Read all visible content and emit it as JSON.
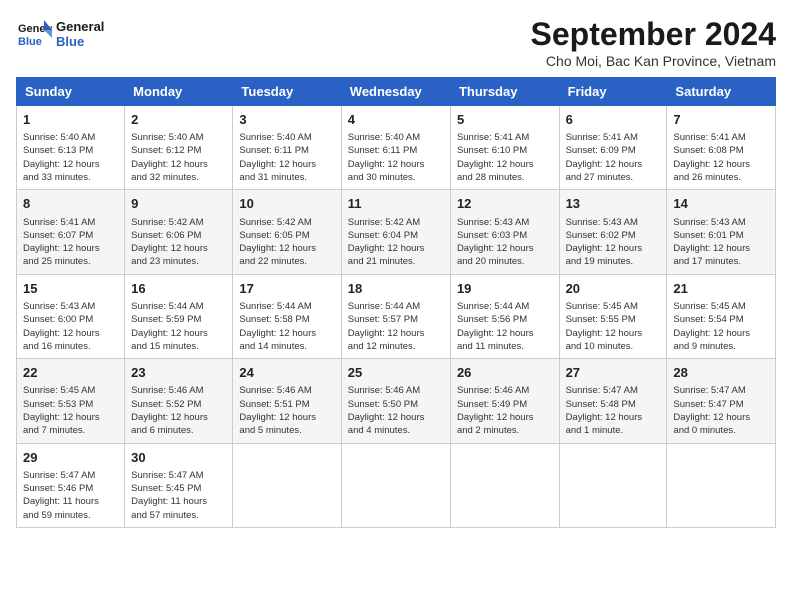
{
  "logo": {
    "line1": "General",
    "line2": "Blue"
  },
  "title": "September 2024",
  "location": "Cho Moi, Bac Kan Province, Vietnam",
  "headers": [
    "Sunday",
    "Monday",
    "Tuesday",
    "Wednesday",
    "Thursday",
    "Friday",
    "Saturday"
  ],
  "weeks": [
    [
      {
        "day": "1",
        "info": "Sunrise: 5:40 AM\nSunset: 6:13 PM\nDaylight: 12 hours\nand 33 minutes."
      },
      {
        "day": "2",
        "info": "Sunrise: 5:40 AM\nSunset: 6:12 PM\nDaylight: 12 hours\nand 32 minutes."
      },
      {
        "day": "3",
        "info": "Sunrise: 5:40 AM\nSunset: 6:11 PM\nDaylight: 12 hours\nand 31 minutes."
      },
      {
        "day": "4",
        "info": "Sunrise: 5:40 AM\nSunset: 6:11 PM\nDaylight: 12 hours\nand 30 minutes."
      },
      {
        "day": "5",
        "info": "Sunrise: 5:41 AM\nSunset: 6:10 PM\nDaylight: 12 hours\nand 28 minutes."
      },
      {
        "day": "6",
        "info": "Sunrise: 5:41 AM\nSunset: 6:09 PM\nDaylight: 12 hours\nand 27 minutes."
      },
      {
        "day": "7",
        "info": "Sunrise: 5:41 AM\nSunset: 6:08 PM\nDaylight: 12 hours\nand 26 minutes."
      }
    ],
    [
      {
        "day": "8",
        "info": "Sunrise: 5:41 AM\nSunset: 6:07 PM\nDaylight: 12 hours\nand 25 minutes."
      },
      {
        "day": "9",
        "info": "Sunrise: 5:42 AM\nSunset: 6:06 PM\nDaylight: 12 hours\nand 23 minutes."
      },
      {
        "day": "10",
        "info": "Sunrise: 5:42 AM\nSunset: 6:05 PM\nDaylight: 12 hours\nand 22 minutes."
      },
      {
        "day": "11",
        "info": "Sunrise: 5:42 AM\nSunset: 6:04 PM\nDaylight: 12 hours\nand 21 minutes."
      },
      {
        "day": "12",
        "info": "Sunrise: 5:43 AM\nSunset: 6:03 PM\nDaylight: 12 hours\nand 20 minutes."
      },
      {
        "day": "13",
        "info": "Sunrise: 5:43 AM\nSunset: 6:02 PM\nDaylight: 12 hours\nand 19 minutes."
      },
      {
        "day": "14",
        "info": "Sunrise: 5:43 AM\nSunset: 6:01 PM\nDaylight: 12 hours\nand 17 minutes."
      }
    ],
    [
      {
        "day": "15",
        "info": "Sunrise: 5:43 AM\nSunset: 6:00 PM\nDaylight: 12 hours\nand 16 minutes."
      },
      {
        "day": "16",
        "info": "Sunrise: 5:44 AM\nSunset: 5:59 PM\nDaylight: 12 hours\nand 15 minutes."
      },
      {
        "day": "17",
        "info": "Sunrise: 5:44 AM\nSunset: 5:58 PM\nDaylight: 12 hours\nand 14 minutes."
      },
      {
        "day": "18",
        "info": "Sunrise: 5:44 AM\nSunset: 5:57 PM\nDaylight: 12 hours\nand 12 minutes."
      },
      {
        "day": "19",
        "info": "Sunrise: 5:44 AM\nSunset: 5:56 PM\nDaylight: 12 hours\nand 11 minutes."
      },
      {
        "day": "20",
        "info": "Sunrise: 5:45 AM\nSunset: 5:55 PM\nDaylight: 12 hours\nand 10 minutes."
      },
      {
        "day": "21",
        "info": "Sunrise: 5:45 AM\nSunset: 5:54 PM\nDaylight: 12 hours\nand 9 minutes."
      }
    ],
    [
      {
        "day": "22",
        "info": "Sunrise: 5:45 AM\nSunset: 5:53 PM\nDaylight: 12 hours\nand 7 minutes."
      },
      {
        "day": "23",
        "info": "Sunrise: 5:46 AM\nSunset: 5:52 PM\nDaylight: 12 hours\nand 6 minutes."
      },
      {
        "day": "24",
        "info": "Sunrise: 5:46 AM\nSunset: 5:51 PM\nDaylight: 12 hours\nand 5 minutes."
      },
      {
        "day": "25",
        "info": "Sunrise: 5:46 AM\nSunset: 5:50 PM\nDaylight: 12 hours\nand 4 minutes."
      },
      {
        "day": "26",
        "info": "Sunrise: 5:46 AM\nSunset: 5:49 PM\nDaylight: 12 hours\nand 2 minutes."
      },
      {
        "day": "27",
        "info": "Sunrise: 5:47 AM\nSunset: 5:48 PM\nDaylight: 12 hours\nand 1 minute."
      },
      {
        "day": "28",
        "info": "Sunrise: 5:47 AM\nSunset: 5:47 PM\nDaylight: 12 hours\nand 0 minutes."
      }
    ],
    [
      {
        "day": "29",
        "info": "Sunrise: 5:47 AM\nSunset: 5:46 PM\nDaylight: 11 hours\nand 59 minutes."
      },
      {
        "day": "30",
        "info": "Sunrise: 5:47 AM\nSunset: 5:45 PM\nDaylight: 11 hours\nand 57 minutes."
      },
      {
        "day": "",
        "info": ""
      },
      {
        "day": "",
        "info": ""
      },
      {
        "day": "",
        "info": ""
      },
      {
        "day": "",
        "info": ""
      },
      {
        "day": "",
        "info": ""
      }
    ]
  ]
}
